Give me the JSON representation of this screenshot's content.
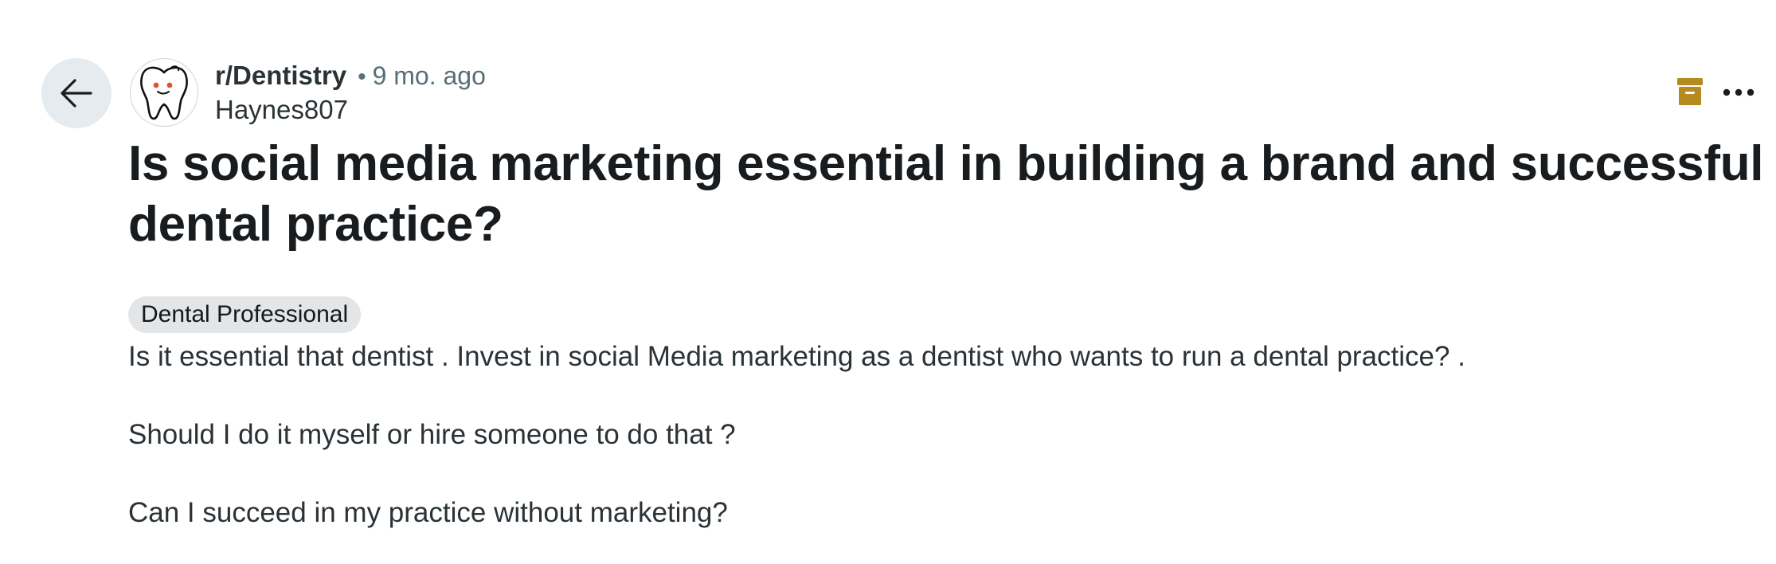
{
  "post": {
    "subreddit": "r/Dentistry",
    "separator": "•",
    "time_ago": "9 mo. ago",
    "author": "Haynes807",
    "title": "Is social media marketing essential in building a brand and successful dental practice?",
    "flair": "Dental Professional",
    "body": [
      "Is it essential that dentist . Invest in social Media marketing as a dentist who wants to run a dental practice? .",
      "Should I do it myself or hire someone to do that ?",
      "Can I succeed in my practice without marketing?"
    ]
  },
  "icons": {
    "back": "arrow-left-icon",
    "avatar": "tooth-icon",
    "archived": "archive-box-icon",
    "overflow": "more-horizontal-icon"
  },
  "colors": {
    "archive_icon": "#b58a1e",
    "back_button_bg": "#e5ebee",
    "flair_bg": "#e3e5e6",
    "tooth_eyes": "#e0552d",
    "meta_gray": "#576f76"
  }
}
